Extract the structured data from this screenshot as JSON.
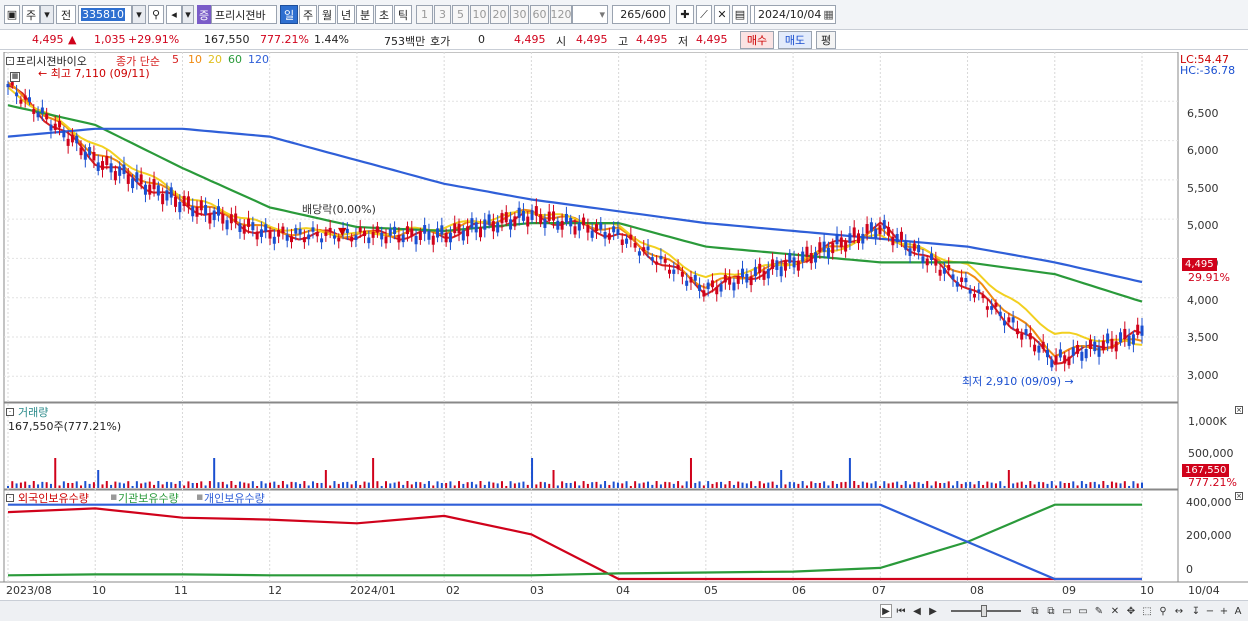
{
  "toolbar": {
    "period_type": "주",
    "period_type2": "전",
    "code": "335810",
    "name_badge": "증",
    "stock_name": "프리시젼바",
    "intervals": [
      "일",
      "주",
      "월",
      "년",
      "분",
      "초",
      "틱"
    ],
    "selected_interval": "일",
    "minute_options": [
      "1",
      "3",
      "5",
      "10",
      "20",
      "30",
      "60",
      "120"
    ],
    "count": "265",
    "count_total": "/600",
    "date": "2024/10/04"
  },
  "quote": {
    "price": "4,495",
    "change": "1,035",
    "change_pct": "+29.91%",
    "volume": "167,550",
    "volume_pct": "777.21%",
    "turnover_pct": "1.44%",
    "amount": "753백만",
    "hoga_label": "호가",
    "hoga_value": "0",
    "hoga_price": "4,495",
    "open_label": "시",
    "open": "4,495",
    "high_label": "고",
    "high": "4,495",
    "low_label": "저",
    "low": "4,495",
    "buy_label": "매수",
    "sell_label": "매도",
    "eval_label": "평"
  },
  "price_panel": {
    "name": "프리시젼바이오",
    "ma_label": "종가 단순",
    "ma_periods": [
      "5",
      "10",
      "20",
      "60",
      "120"
    ],
    "high_note": "최고 7,110 (09/11)",
    "low_note": "최저 2,910 (09/09)",
    "dividend_note": "배당락(0.00%)",
    "lc": "LC:54.47",
    "hc": "HC:-36.78",
    "last_price_tag": "4,495",
    "last_pct_tag": "29.91%",
    "y_ticks": [
      "6,500",
      "6,000",
      "5,500",
      "5,000",
      "4,500",
      "4,000",
      "3,500",
      "3,000"
    ]
  },
  "volume_panel": {
    "title": "거래량",
    "value": "167,550주(777.21%)",
    "y_ticks": [
      "1,000K",
      "500,000"
    ],
    "last_tag": "167,550",
    "last_pct": "777.21%"
  },
  "holding_panel": {
    "series": [
      "외국인보유수량",
      "기관보유수량",
      "개인보유수량"
    ],
    "y_ticks": [
      "400,000",
      "200,000",
      "0"
    ]
  },
  "x_axis": [
    "2023/08",
    "10",
    "11",
    "12",
    "2024/01",
    "02",
    "03",
    "04",
    "05",
    "06",
    "07",
    "08",
    "09",
    "10"
  ],
  "x_end_label": "10/04",
  "colors": {
    "up": "#d0021b",
    "down": "#1a4fd0",
    "ma5": "#d62020",
    "ma10": "#f08a10",
    "ma20": "#f2d020",
    "ma60": "#2a9a3a",
    "ma120": "#2f5fd8"
  },
  "chart_data": {
    "type": "line",
    "title": "프리시젼바이오",
    "x": [
      "2023/08",
      "10",
      "11",
      "12",
      "2024/01",
      "02",
      "03",
      "04",
      "05",
      "06",
      "07",
      "08",
      "09",
      "10"
    ],
    "series": [
      {
        "name": "5",
        "values": [
          6700,
          5750,
          5200,
          4800,
          4800,
          4800,
          5050,
          4800,
          4100,
          4450,
          4900,
          4150,
          3200,
          3550
        ]
      },
      {
        "name": "10",
        "values": [
          6700,
          5850,
          5250,
          4850,
          4800,
          4850,
          5100,
          4850,
          4150,
          4450,
          4850,
          4300,
          3300,
          3450
        ]
      },
      {
        "name": "20",
        "values": [
          6650,
          5950,
          5300,
          4900,
          4800,
          4900,
          5100,
          4900,
          4250,
          4450,
          4800,
          4400,
          3550,
          3400
        ]
      },
      {
        "name": "60",
        "values": [
          6450,
          6200,
          5650,
          5150,
          4900,
          4850,
          4950,
          4950,
          4650,
          4550,
          4450,
          4450,
          4300,
          3950
        ]
      },
      {
        "name": "120",
        "values": [
          6050,
          6150,
          6150,
          6050,
          5750,
          5450,
          5250,
          5100,
          4950,
          4850,
          4750,
          4650,
          4450,
          4200
        ]
      }
    ],
    "ylim": [
      2800,
      7000
    ]
  }
}
